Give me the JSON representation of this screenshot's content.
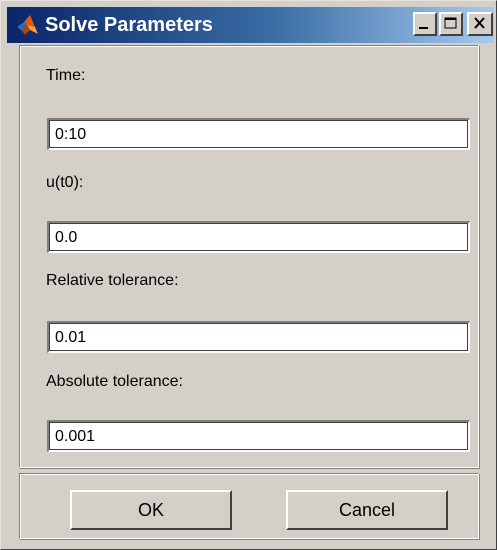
{
  "window": {
    "title": "Solve Parameters",
    "icon": "matlab-logo-icon",
    "controls": [
      "minimize-icon",
      "maximize-icon",
      "close-icon"
    ]
  },
  "form": {
    "time_label": "Time:",
    "time_value": "0:10",
    "u0_label": "u(t0):",
    "u0_value": "0.0",
    "reltol_label": "Relative tolerance:",
    "reltol_value": "0.01",
    "abstol_label": "Absolute tolerance:",
    "abstol_value": "0.001"
  },
  "buttons": {
    "ok_label": "OK",
    "cancel_label": "Cancel"
  },
  "colors": {
    "titlebar_start": "#0a246a",
    "titlebar_end": "#a6caf0",
    "face": "#d4d0c8"
  }
}
